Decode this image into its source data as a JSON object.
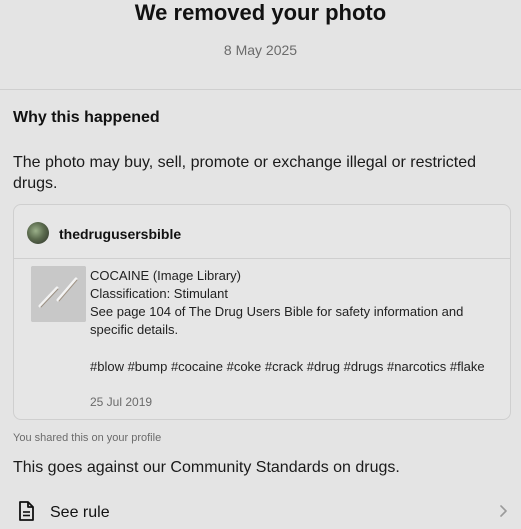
{
  "header": {
    "title": "We removed your photo",
    "date": "8 May 2025"
  },
  "why": {
    "heading": "Why this happened",
    "reason": "The photo may buy, sell, promote or exchange illegal or restricted drugs."
  },
  "post": {
    "username": "thedrugusersbible",
    "lines": [
      "COCAINE (Image Library)",
      "Classification: Stimulant",
      "See page 104 of The Drug Users Bible for safety information and specific details."
    ],
    "hashtags": "#blow #bump #cocaine #coke #crack #drug #drugs #narcotics #flake",
    "date": "25 Jul 2019"
  },
  "shared_note": "You shared this on your profile",
  "standards_text": "This goes against our Community Standards on drugs.",
  "see_rule": {
    "label": "See rule",
    "icon": "document-icon"
  }
}
